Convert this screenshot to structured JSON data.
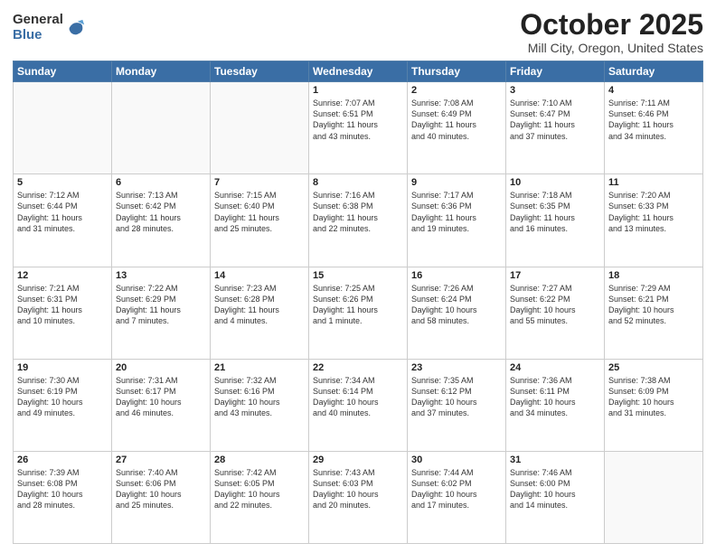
{
  "header": {
    "logo_general": "General",
    "logo_blue": "Blue",
    "month_title": "October 2025",
    "location": "Mill City, Oregon, United States"
  },
  "days_of_week": [
    "Sunday",
    "Monday",
    "Tuesday",
    "Wednesday",
    "Thursday",
    "Friday",
    "Saturday"
  ],
  "weeks": [
    [
      {
        "num": "",
        "info": ""
      },
      {
        "num": "",
        "info": ""
      },
      {
        "num": "",
        "info": ""
      },
      {
        "num": "1",
        "info": "Sunrise: 7:07 AM\nSunset: 6:51 PM\nDaylight: 11 hours\nand 43 minutes."
      },
      {
        "num": "2",
        "info": "Sunrise: 7:08 AM\nSunset: 6:49 PM\nDaylight: 11 hours\nand 40 minutes."
      },
      {
        "num": "3",
        "info": "Sunrise: 7:10 AM\nSunset: 6:47 PM\nDaylight: 11 hours\nand 37 minutes."
      },
      {
        "num": "4",
        "info": "Sunrise: 7:11 AM\nSunset: 6:46 PM\nDaylight: 11 hours\nand 34 minutes."
      }
    ],
    [
      {
        "num": "5",
        "info": "Sunrise: 7:12 AM\nSunset: 6:44 PM\nDaylight: 11 hours\nand 31 minutes."
      },
      {
        "num": "6",
        "info": "Sunrise: 7:13 AM\nSunset: 6:42 PM\nDaylight: 11 hours\nand 28 minutes."
      },
      {
        "num": "7",
        "info": "Sunrise: 7:15 AM\nSunset: 6:40 PM\nDaylight: 11 hours\nand 25 minutes."
      },
      {
        "num": "8",
        "info": "Sunrise: 7:16 AM\nSunset: 6:38 PM\nDaylight: 11 hours\nand 22 minutes."
      },
      {
        "num": "9",
        "info": "Sunrise: 7:17 AM\nSunset: 6:36 PM\nDaylight: 11 hours\nand 19 minutes."
      },
      {
        "num": "10",
        "info": "Sunrise: 7:18 AM\nSunset: 6:35 PM\nDaylight: 11 hours\nand 16 minutes."
      },
      {
        "num": "11",
        "info": "Sunrise: 7:20 AM\nSunset: 6:33 PM\nDaylight: 11 hours\nand 13 minutes."
      }
    ],
    [
      {
        "num": "12",
        "info": "Sunrise: 7:21 AM\nSunset: 6:31 PM\nDaylight: 11 hours\nand 10 minutes."
      },
      {
        "num": "13",
        "info": "Sunrise: 7:22 AM\nSunset: 6:29 PM\nDaylight: 11 hours\nand 7 minutes."
      },
      {
        "num": "14",
        "info": "Sunrise: 7:23 AM\nSunset: 6:28 PM\nDaylight: 11 hours\nand 4 minutes."
      },
      {
        "num": "15",
        "info": "Sunrise: 7:25 AM\nSunset: 6:26 PM\nDaylight: 11 hours\nand 1 minute."
      },
      {
        "num": "16",
        "info": "Sunrise: 7:26 AM\nSunset: 6:24 PM\nDaylight: 10 hours\nand 58 minutes."
      },
      {
        "num": "17",
        "info": "Sunrise: 7:27 AM\nSunset: 6:22 PM\nDaylight: 10 hours\nand 55 minutes."
      },
      {
        "num": "18",
        "info": "Sunrise: 7:29 AM\nSunset: 6:21 PM\nDaylight: 10 hours\nand 52 minutes."
      }
    ],
    [
      {
        "num": "19",
        "info": "Sunrise: 7:30 AM\nSunset: 6:19 PM\nDaylight: 10 hours\nand 49 minutes."
      },
      {
        "num": "20",
        "info": "Sunrise: 7:31 AM\nSunset: 6:17 PM\nDaylight: 10 hours\nand 46 minutes."
      },
      {
        "num": "21",
        "info": "Sunrise: 7:32 AM\nSunset: 6:16 PM\nDaylight: 10 hours\nand 43 minutes."
      },
      {
        "num": "22",
        "info": "Sunrise: 7:34 AM\nSunset: 6:14 PM\nDaylight: 10 hours\nand 40 minutes."
      },
      {
        "num": "23",
        "info": "Sunrise: 7:35 AM\nSunset: 6:12 PM\nDaylight: 10 hours\nand 37 minutes."
      },
      {
        "num": "24",
        "info": "Sunrise: 7:36 AM\nSunset: 6:11 PM\nDaylight: 10 hours\nand 34 minutes."
      },
      {
        "num": "25",
        "info": "Sunrise: 7:38 AM\nSunset: 6:09 PM\nDaylight: 10 hours\nand 31 minutes."
      }
    ],
    [
      {
        "num": "26",
        "info": "Sunrise: 7:39 AM\nSunset: 6:08 PM\nDaylight: 10 hours\nand 28 minutes."
      },
      {
        "num": "27",
        "info": "Sunrise: 7:40 AM\nSunset: 6:06 PM\nDaylight: 10 hours\nand 25 minutes."
      },
      {
        "num": "28",
        "info": "Sunrise: 7:42 AM\nSunset: 6:05 PM\nDaylight: 10 hours\nand 22 minutes."
      },
      {
        "num": "29",
        "info": "Sunrise: 7:43 AM\nSunset: 6:03 PM\nDaylight: 10 hours\nand 20 minutes."
      },
      {
        "num": "30",
        "info": "Sunrise: 7:44 AM\nSunset: 6:02 PM\nDaylight: 10 hours\nand 17 minutes."
      },
      {
        "num": "31",
        "info": "Sunrise: 7:46 AM\nSunset: 6:00 PM\nDaylight: 10 hours\nand 14 minutes."
      },
      {
        "num": "",
        "info": ""
      }
    ]
  ]
}
